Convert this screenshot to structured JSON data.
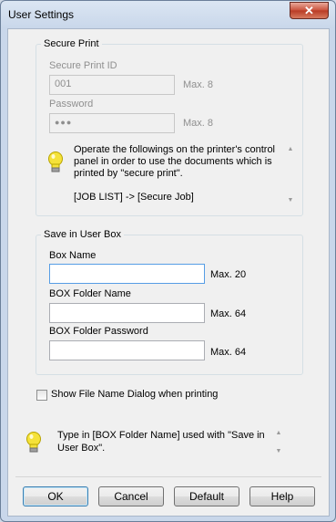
{
  "window": {
    "title": "User Settings",
    "close_symbol": "✕"
  },
  "secure_print": {
    "legend": "Secure Print",
    "id_label": "Secure Print ID",
    "id_value": "001",
    "id_max": "Max. 8",
    "password_label": "Password",
    "password_value": "●●●",
    "password_max": "Max. 8",
    "info_line1": "Operate the followings on the printer's control",
    "info_line2": "panel in order to use the documents which is",
    "info_line3": "printed by \"secure print\".",
    "info_line4": "[JOB LIST] -> [Secure Job]"
  },
  "user_box": {
    "legend": "Save in User Box",
    "box_name_label": "Box Name",
    "box_name_value": "",
    "box_name_max": "Max. 20",
    "folder_name_label": "BOX Folder Name",
    "folder_name_value": "",
    "folder_name_max": "Max. 64",
    "folder_password_label": "BOX Folder Password",
    "folder_password_value": "",
    "folder_password_max": "Max. 64"
  },
  "show_dialog": {
    "label": "Show File Name Dialog when printing",
    "checked": false
  },
  "hint": {
    "line1": "Type in [BOX Folder Name] used with \"Save in",
    "line2": "User Box\"."
  },
  "buttons": {
    "ok": "OK",
    "cancel": "Cancel",
    "default": "Default",
    "help": "Help"
  },
  "icons": {
    "info": "lightbulb-icon",
    "close": "close-icon",
    "scroll_up": "scroll-up-arrow-icon",
    "scroll_down": "scroll-down-arrow-icon"
  },
  "colors": {
    "bulb": "#f5e23a",
    "default_button_border": "#3c7fb1",
    "close_button": "#c9503a"
  }
}
